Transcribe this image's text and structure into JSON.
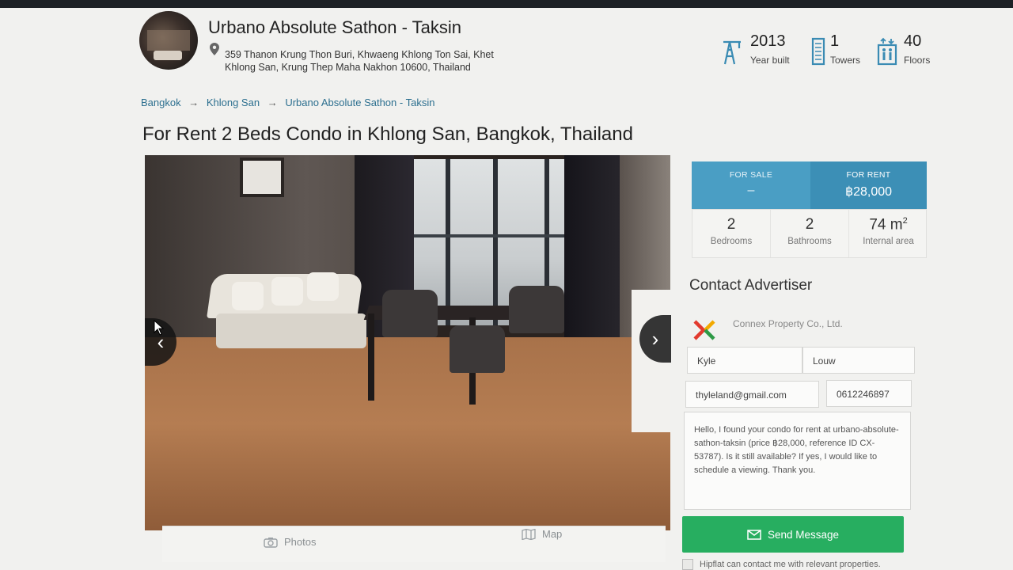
{
  "building": {
    "name": "Urbano Absolute Sathon - Taksin",
    "address_line1": "359 Thanon Krung Thon Buri, Khwaeng Khlong Ton Sai, Khet",
    "address_line2": "Khlong San, Krung Thep Maha Nakhon 10600, Thailand",
    "stats": [
      {
        "value": "2013",
        "label": "Year built",
        "icon": "crane-icon"
      },
      {
        "value": "1",
        "label": "Towers",
        "icon": "tower-icon"
      },
      {
        "value": "40",
        "label": "Floors",
        "icon": "elevator-icon"
      }
    ]
  },
  "breadcrumb": [
    "Bangkok",
    "Khlong San",
    "Urbano Absolute Sathon - Taksin"
  ],
  "breadcrumb_separator": "→",
  "listing_title": "For Rent 2 Beds Condo in Khlong San, Bangkok, Thailand",
  "gallery": {
    "tabs": [
      {
        "label": "Photos",
        "icon": "camera-icon"
      },
      {
        "label": "Map",
        "icon": "map-icon"
      }
    ],
    "prev_icon": "‹",
    "next_icon": "›"
  },
  "pricing": {
    "sale_label": "FOR SALE",
    "sale_value": "–",
    "rent_label": "FOR RENT",
    "rent_value": "฿28,000"
  },
  "facts": [
    {
      "value": "2",
      "label": "Bedrooms"
    },
    {
      "value": "2",
      "label": "Bathrooms"
    },
    {
      "value": "74 m",
      "sup": "2",
      "label": "Internal area"
    }
  ],
  "contact": {
    "heading": "Contact Advertiser",
    "agency": "Connex Property Co., Ltd.",
    "first_name": "Kyle",
    "last_name": "Louw",
    "email": "thyleland@gmail.com",
    "phone": "0612246897",
    "message": "Hello, I found your condo for rent at urbano-absolute-sathon-taksin (price ฿28,000, reference ID CX-53787). Is it still available? If yes, I would like to schedule a viewing. Thank you.",
    "send_label": "Send Message",
    "consent": "Hipflat can contact me with relevant properties."
  },
  "colors": {
    "accent_blue": "#3c8fb6",
    "sale_blue": "#4a9ec4",
    "send_green": "#27ae60",
    "link": "#2c6f8f"
  }
}
